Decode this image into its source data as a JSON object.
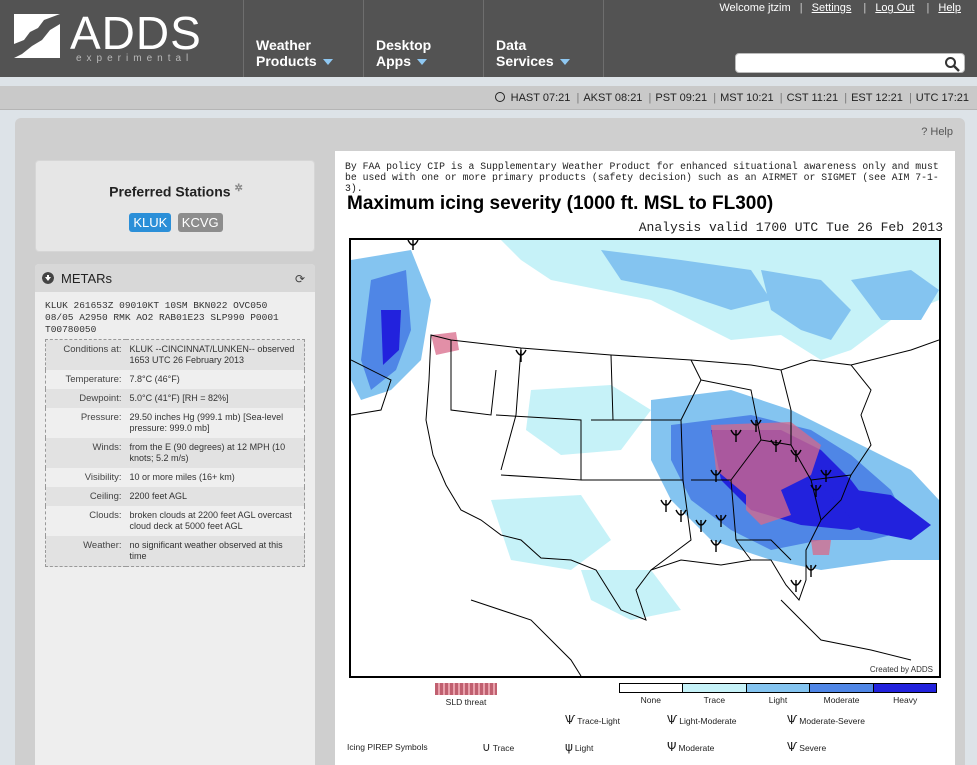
{
  "header": {
    "logo_text": "ADDS",
    "logo_sub": "experimental",
    "nav": [
      {
        "line1": "Weather",
        "line2": "Products"
      },
      {
        "line1": "Desktop",
        "line2": "Apps"
      },
      {
        "line1": "Data",
        "line2": "Services"
      }
    ],
    "welcome": "Welcome jtzim",
    "links": [
      "Settings",
      "Log Out",
      "Help"
    ],
    "search": {
      "value": "",
      "placeholder": ""
    }
  },
  "timebar": {
    "zones": [
      "HAST 07:21",
      "AKST 08:21",
      "PST 09:21",
      "MST 10:21",
      "CST 11:21",
      "EST 12:21",
      "UTC 17:21"
    ]
  },
  "help_label": "Help",
  "preferred": {
    "title": "Preferred Stations",
    "stations": [
      {
        "code": "KLUK",
        "active": true
      },
      {
        "code": "KCVG",
        "active": false
      }
    ]
  },
  "metars": {
    "title": "METARs",
    "raw": "KLUK 261653Z 09010KT 10SM BKN022 OVC050\n08/05 A2950 RMK AO2 RAB01E23 SLP990 P0001\nT00780050",
    "rows": [
      {
        "label": "Conditions at:",
        "value": "KLUK --CINCINNAT/LUNKEN-- observed 1653 UTC 26 February 2013"
      },
      {
        "label": "Temperature:",
        "value": "7.8°C (46°F)"
      },
      {
        "label": "Dewpoint:",
        "value": "5.0°C (41°F) [RH = 82%]"
      },
      {
        "label": "Pressure:",
        "value": "29.50 inches Hg (999.1 mb) [Sea-level pressure: 999.0 mb]"
      },
      {
        "label": "Winds:",
        "value": "from the E (90 degrees) at 12 MPH (10 knots; 5.2 m/s)"
      },
      {
        "label": "Visibility:",
        "value": "10 or more miles (16+ km)"
      },
      {
        "label": "Ceiling:",
        "value": "2200 feet AGL"
      },
      {
        "label": "Clouds:",
        "value": "broken clouds at 2200 feet AGL overcast cloud deck at 5000 feet AGL"
      },
      {
        "label": "Weather:",
        "value": "no significant weather observed at this time"
      }
    ]
  },
  "map": {
    "disclaimer": "By FAA policy CIP is a Supplementary Weather Product for enhanced situational awareness only and must be used with one or more primary products (safety decision) such as an AIRMET or SIGMET (see AIM 7-1-3).",
    "title": "Maximum icing severity (1000 ft. MSL to FL300)",
    "subtitle": "Analysis valid 1700 UTC Tue 26 Feb 2013",
    "credit": "Created by ADDS",
    "sld_label": "SLD threat",
    "severity": [
      {
        "label": "None",
        "color": "#ffffff"
      },
      {
        "label": "Trace",
        "color": "#c6f2f8"
      },
      {
        "label": "Light",
        "color": "#84c4f0"
      },
      {
        "label": "Moderate",
        "color": "#4f86e6"
      },
      {
        "label": "Heavy",
        "color": "#2222dd"
      }
    ],
    "pirep_title": "Icing PIREP Symbols",
    "pireps": [
      {
        "label": "Trace-Light"
      },
      {
        "label": "Light-Moderate"
      },
      {
        "label": "Moderate-Severe"
      },
      {
        "label": "Trace"
      },
      {
        "label": "Light"
      },
      {
        "label": "Moderate"
      },
      {
        "label": "Severe"
      }
    ]
  }
}
